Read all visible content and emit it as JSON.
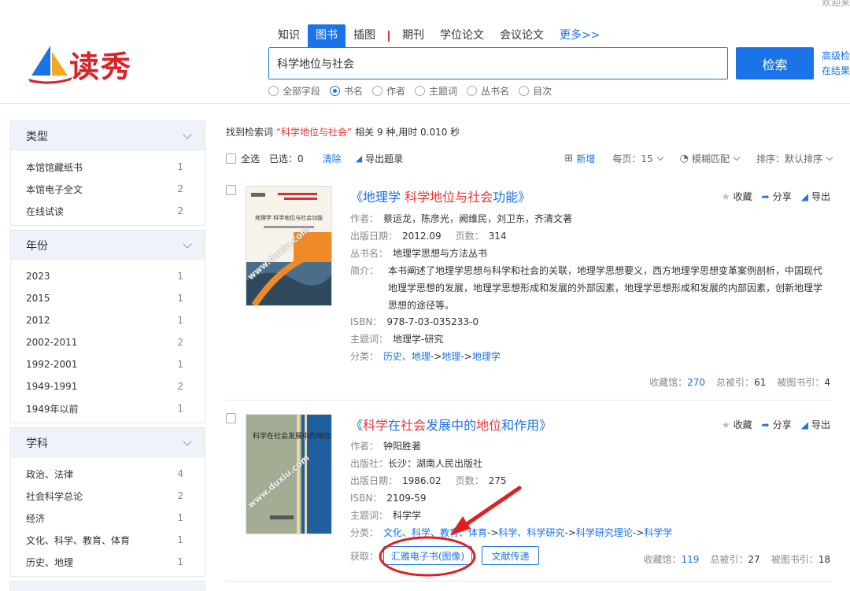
{
  "corner_text": "欢迎来",
  "logo": {
    "text": "读秀"
  },
  "tabs": [
    {
      "label": "知识"
    },
    {
      "label": "图书"
    },
    {
      "label": "插图"
    },
    {
      "label": "期刊"
    },
    {
      "label": "学位论文"
    },
    {
      "label": "会议论文"
    },
    {
      "label": "更多>>"
    }
  ],
  "search": {
    "value": "科学地位与社会",
    "button": "检索",
    "adv1": "高级检",
    "adv2": "在结果"
  },
  "radios": [
    {
      "label": "全部字段"
    },
    {
      "label": "书名"
    },
    {
      "label": "作者"
    },
    {
      "label": "主题词"
    },
    {
      "label": "丛书名"
    },
    {
      "label": "目次"
    }
  ],
  "facets": [
    {
      "title": "类型",
      "items": [
        {
          "label": "本馆馆藏纸书",
          "count": "1"
        },
        {
          "label": "本馆电子全文",
          "count": "2"
        },
        {
          "label": "在线试读",
          "count": "2"
        }
      ]
    },
    {
      "title": "年份",
      "items": [
        {
          "label": "2023",
          "count": "1"
        },
        {
          "label": "2015",
          "count": "1"
        },
        {
          "label": "2012",
          "count": "1"
        },
        {
          "label": "2002-2011",
          "count": "2"
        },
        {
          "label": "1992-2001",
          "count": "1"
        },
        {
          "label": "1949-1991",
          "count": "2"
        },
        {
          "label": "1949年以前",
          "count": "1"
        }
      ]
    },
    {
      "title": "学科",
      "items": [
        {
          "label": "政治、法律",
          "count": "4"
        },
        {
          "label": "社会科学总论",
          "count": "2"
        },
        {
          "label": "经济",
          "count": "1"
        },
        {
          "label": "文化、科学、教育、体育",
          "count": "1"
        },
        {
          "label": "历史、地理",
          "count": "1"
        }
      ]
    }
  ],
  "summary": {
    "prefix": "找到检索词",
    "keyword": "“科学地位与社会”",
    "suffix": "相关 9 种,用时 0.010 秒"
  },
  "toolbar": {
    "select_all": "全选",
    "selected": "已选：0",
    "clear": "清除",
    "export": "导出题录",
    "new": "新增",
    "per_page": "每页：15",
    "fuzzy": "模糊匹配",
    "sort": "排序：默认排序"
  },
  "actions": {
    "collect": "收藏",
    "share": "分享",
    "export": "导出"
  },
  "results": [
    {
      "title_parts": [
        {
          "t": "《地理学 ",
          "hl": false
        },
        {
          "t": "科学地位与社会",
          "hl": true
        },
        {
          "t": "功能》",
          "hl": false
        }
      ],
      "author_k": "作者：",
      "author": "蔡运龙，陈彦光，阙维民，刘卫东，齐清文著",
      "date_k": "出版日期：",
      "date": "2012.09",
      "pages_k": "页数：",
      "pages": "314",
      "series_k": "丛书名：",
      "series": "地理学思想与方法丛书",
      "abstract_k": "简介：",
      "abstract": "本书阐述了地理学思想与科学和社会的关联，地理学思想要义，西方地理学思想变革案例剖析，中国现代地理学思想的发展，地理学思想形成和发展的外部因素，地理学思想形成和发展的内部因素，创新地理学思想的途径等。",
      "isbn_k": "ISBN：",
      "isbn": "978-7-03-035233-0",
      "subject_k": "主题词：",
      "subject": "地理学-研究",
      "class_k": "分类：",
      "class_links": [
        "历史、地理",
        "地理",
        "地理学"
      ],
      "cover_title": "地理学 科学地位与社会功能",
      "stats": {
        "lib_k": "收藏馆：",
        "lib": "270",
        "cited_k": "总被引：",
        "cited": "61",
        "book_k": "被图书引：",
        "book": "4"
      }
    },
    {
      "title_parts": [
        {
          "t": "《",
          "hl": false
        },
        {
          "t": "科学",
          "hl": true
        },
        {
          "t": "在",
          "hl": false
        },
        {
          "t": "社会",
          "hl": true
        },
        {
          "t": "发展中的",
          "hl": false
        },
        {
          "t": "地位",
          "hl": true
        },
        {
          "t": "和作用》",
          "hl": false
        }
      ],
      "author_k": "作者：",
      "author": "钟阳胜著",
      "publisher_k": "出版社：",
      "publisher": "长沙：湖南人民出版社",
      "date_k": "出版日期：",
      "date": "1986.02",
      "pages_k": "页数：",
      "pages": "275",
      "isbn_k": "ISBN：",
      "isbn": "2109-59",
      "subject_k": "主题词：",
      "subject": "科学学",
      "class_k": "分类：",
      "class_links": [
        "文化、科学、教育、体育",
        "科学、科学研究",
        "科学研究理论",
        "科学学"
      ],
      "cover_title": "科学在社会发展中的地位和作用",
      "get_k": "获取：",
      "get_btn1": "汇雅电子书(图像)",
      "get_btn2": "文献传递",
      "stats": {
        "lib_k": "收藏馆：",
        "lib": "119",
        "cited_k": "总被引：",
        "cited": "27",
        "book_k": "被图书引：",
        "book": "18"
      }
    }
  ],
  "watermark": "www.duxiu.com",
  "colors": {
    "accent": "#1a73e8",
    "highlight": "#e33333",
    "annotation": "#e02020"
  }
}
